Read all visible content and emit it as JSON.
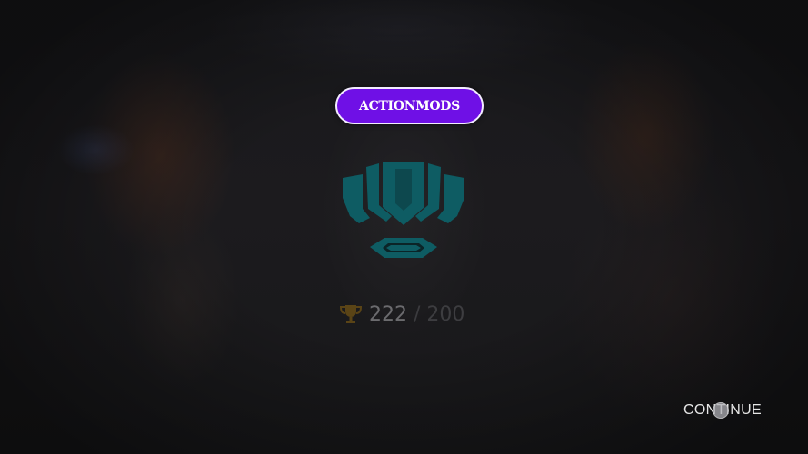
{
  "mod_badge": {
    "label": "ACTIONMODS"
  },
  "rank": {
    "emblem_icon": "rank-crest-icon",
    "emblem_color": "#0e5c63",
    "trophy_icon": "trophy-icon",
    "trophy_color": "#5a4416",
    "trophies": "222",
    "separator": "/",
    "target": "200"
  },
  "footer": {
    "continue_label": "CONTINUE"
  },
  "colors": {
    "badge_bg": "#6f10e6",
    "badge_border": "#f3ecff"
  }
}
